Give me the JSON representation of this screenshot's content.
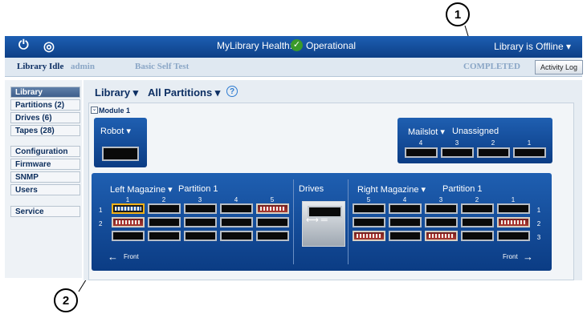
{
  "topbar": {
    "health_label": "MyLibrary Health:",
    "health_status": "Operational",
    "offline_label": "Library is Offline ▾"
  },
  "statusrow": {
    "state": "Library Idle",
    "user": "admin",
    "task": "Basic Self Test",
    "result": "COMPLETED",
    "activity_log": "Activity Log"
  },
  "sidenav": {
    "group1": [
      "Library",
      "Partitions (2)",
      "Drives (6)",
      "Tapes (28)"
    ],
    "group2": [
      "Configuration",
      "Firmware",
      "SNMP",
      "Users"
    ],
    "group3": [
      "Service"
    ]
  },
  "main": {
    "library_menu": "Library ▾",
    "partitions_menu": "All Partitions ▾",
    "help": "?",
    "module_toggle": "⌄",
    "module_label": "Module 1",
    "robot_label": "Robot ▾",
    "mailslot_label": "Mailslot ▾",
    "mailslot_status": "Unassigned",
    "mailslot_numbers": [
      "4",
      "3",
      "2",
      "1"
    ],
    "left_mag_label": "Left Magazine ▾",
    "left_partition": "Partition 1",
    "left_columns": [
      "1",
      "2",
      "3",
      "4",
      "5"
    ],
    "drives_label": "Drives",
    "right_mag_label": "Right Magazine ▾",
    "right_partition": "Partition 1",
    "right_columns": [
      "5",
      "4",
      "3",
      "2",
      "1"
    ],
    "row_numbers": [
      "1",
      "2",
      "3"
    ],
    "front_left": "Front",
    "front_right": "Front"
  },
  "callouts": [
    "1",
    "2"
  ],
  "colors": {
    "accent_blue": "#0d3f86",
    "health_green": "#3a9a2a",
    "selected_slot": "#f2b21a"
  }
}
